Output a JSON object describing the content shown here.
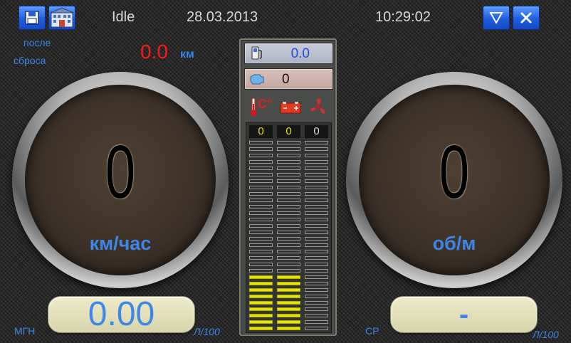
{
  "header": {
    "save_icon": "floppy-disk-icon",
    "building_icon": "building-icon",
    "status": "Idle",
    "date": "28.03.2013",
    "time": "10:29:02",
    "dropdown_icon": "triangle-down-icon",
    "close_icon": "close-x-icon"
  },
  "trip": {
    "label_line1": "после",
    "label_line2": "сброса",
    "distance": "0.0",
    "distance_unit": "км"
  },
  "speed_gauge": {
    "value": "0",
    "unit": "км/час"
  },
  "rpm_gauge": {
    "value": "0",
    "unit": "об/м"
  },
  "instant_consumption": {
    "label": "МГН",
    "value": "0.00",
    "unit": "Л/100"
  },
  "average_consumption": {
    "label": "СР",
    "value": "-",
    "unit": "Л/100"
  },
  "center": {
    "fuel_icon": "fuel-pump-icon",
    "fuel_value": "0.0",
    "engine_icon": "engine-icon",
    "engine_value": "0",
    "temp_icon": "thermometer-icon",
    "temp_symbol": "C°",
    "battery_icon": "battery-icon",
    "fan_icon": "fan-icon",
    "bars": [
      {
        "name": "temperature",
        "value": "0",
        "lit_segments": 9,
        "total_segments": 30,
        "color": "#e6e20a"
      },
      {
        "name": "battery",
        "value": "0",
        "lit_segments": 9,
        "total_segments": 30,
        "color": "#e6e20a"
      },
      {
        "name": "fan",
        "value": "0",
        "lit_segments": 0,
        "total_segments": 30,
        "color": "#e6e20a"
      }
    ]
  },
  "colors": {
    "accent_blue": "#3d86ea",
    "odometer_red": "#ff1a1a",
    "bar_lit": "#e6e20a"
  }
}
